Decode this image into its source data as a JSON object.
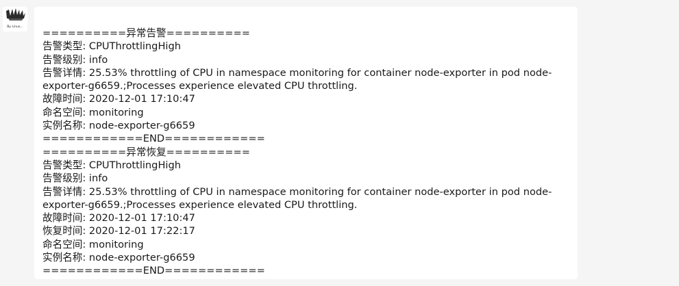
{
  "avatar": {
    "caption": "By Linux..."
  },
  "message": {
    "lines": [
      "==========异常告警==========",
      "告警类型: CPUThrottlingHigh",
      "告警级别: info",
      "告警详情: 25.53% throttling of CPU in namespace monitoring for container node-exporter in pod node-exporter-g6659.;Processes experience elevated CPU throttling.",
      "故障时间: 2020-12-01 17:10:47",
      "命名空间: monitoring",
      "实例名称: node-exporter-g6659",
      "============END============",
      "==========异常恢复==========",
      "告警类型: CPUThrottlingHigh",
      "告警级别: info",
      "告警详情: 25.53% throttling of CPU in namespace monitoring for container node-exporter in pod node-exporter-g6659.;Processes experience elevated CPU throttling.",
      "故障时间: 2020-12-01 17:10:47",
      "恢复时间: 2020-12-01 17:22:17",
      "命名空间: monitoring",
      "实例名称: node-exporter-g6659",
      "============END============"
    ]
  }
}
